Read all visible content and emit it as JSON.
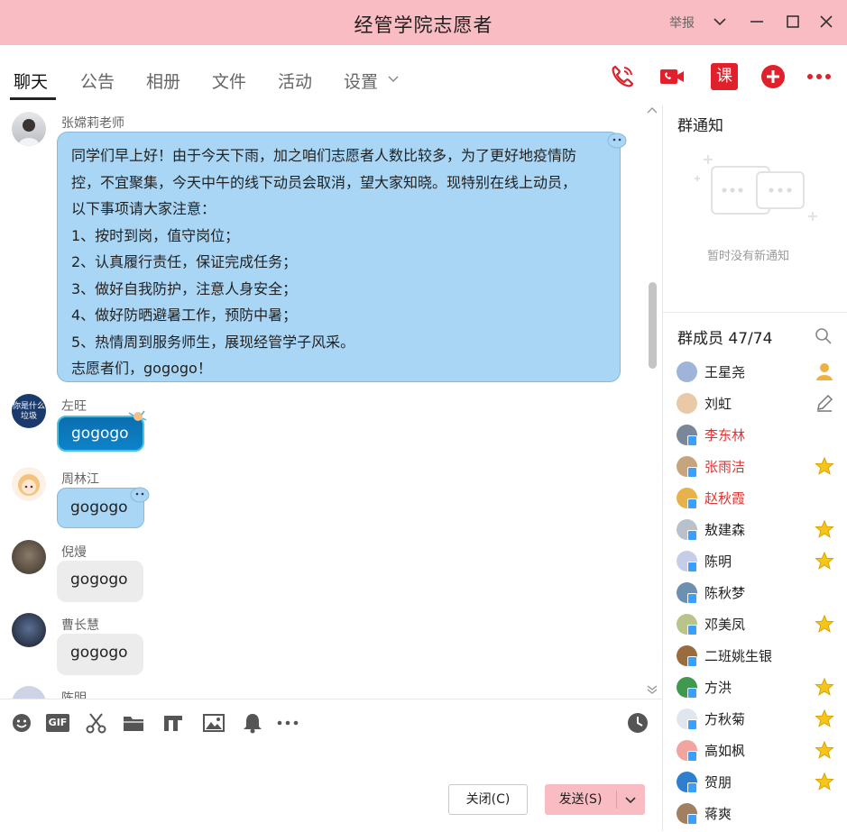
{
  "window": {
    "title": "经管学院志愿者",
    "report_label": "举报"
  },
  "tabs": [
    {
      "label": "聊天",
      "active": true
    },
    {
      "label": "公告"
    },
    {
      "label": "相册"
    },
    {
      "label": "文件"
    },
    {
      "label": "活动"
    },
    {
      "label": "设置"
    }
  ],
  "toolbar_icons": [
    "phone-call-icon",
    "video-call-icon",
    "class-icon",
    "add-app-icon",
    "more-icon"
  ],
  "toolbar_icon_labels": {
    "class": "课"
  },
  "colors": {
    "brand_pink": "#f8bcc2",
    "icon_red": "#e0202a",
    "bubble_blue": "#a9d6f5",
    "bubble_gray": "#ececec",
    "admin_red": "#e23333"
  },
  "messages": [
    {
      "sender": "张嫦莉老师",
      "bubble": "blue",
      "lines": [
        "同学们早上好！由于今天下雨，加之咱们志愿者人数比较多，为了更好地疫情防",
        "控，不宜聚集，今天中午的线下动员会取消，望大家知晓。现特别在线上动员，",
        "以下事项请大家注意：",
        "1、按时到岗，值守岗位；",
        "2、认真履行责任，保证完成任务；",
        "3、做好自我防护，注意人身安全；",
        "4、做好防晒避暑工作，预防中暑；",
        "5、热情周到服务师生，展现经管学子风采。",
        "志愿者们，gogogo！"
      ]
    },
    {
      "sender": "左旺",
      "bubble": "dark",
      "text": "gogogo",
      "avatar_text": "你是什么 垃圾"
    },
    {
      "sender": "周林江",
      "bubble": "blue",
      "text": "gogogo"
    },
    {
      "sender": "倪熳",
      "bubble": "gray",
      "text": "gogogo"
    },
    {
      "sender": "曹长慧",
      "bubble": "gray",
      "text": "gogogo"
    },
    {
      "sender": "陈明",
      "bubble": "none",
      "text": ""
    }
  ],
  "input_toolbar": [
    "emoji-icon",
    "gif-icon",
    "screenshot-icon",
    "folder-icon",
    "font-icon",
    "image-icon",
    "bell-icon",
    "more-icon",
    "history-icon"
  ],
  "input_toolbar_labels": {
    "gif": "GIF"
  },
  "buttons": {
    "close": "关闭(C)",
    "send": "发送(S)"
  },
  "group_notice": {
    "heading": "群通知",
    "empty_text": "暂时没有新通知"
  },
  "members": {
    "heading": "群成员 47/74",
    "list": [
      {
        "name": "王星尧",
        "color": "normal",
        "badge": "owner"
      },
      {
        "name": "刘虹",
        "color": "normal",
        "badge": "edit"
      },
      {
        "name": "李东林",
        "color": "red",
        "badge": ""
      },
      {
        "name": "张雨洁",
        "color": "red",
        "badge": "star"
      },
      {
        "name": "赵秋霞",
        "color": "red",
        "badge": ""
      },
      {
        "name": "敖建森",
        "color": "normal",
        "badge": "star"
      },
      {
        "name": "陈明",
        "color": "normal",
        "badge": "star"
      },
      {
        "name": "陈秋梦",
        "color": "normal",
        "badge": ""
      },
      {
        "name": "邓美凤",
        "color": "normal",
        "badge": "star"
      },
      {
        "name": "二班姚生银",
        "color": "normal",
        "badge": ""
      },
      {
        "name": "方洪",
        "color": "normal",
        "badge": "star"
      },
      {
        "name": "方秋菊",
        "color": "normal",
        "badge": "star"
      },
      {
        "name": "高如枫",
        "color": "normal",
        "badge": "star"
      },
      {
        "name": "贺朋",
        "color": "normal",
        "badge": "star"
      },
      {
        "name": "蒋爽",
        "color": "normal",
        "badge": ""
      }
    ]
  }
}
